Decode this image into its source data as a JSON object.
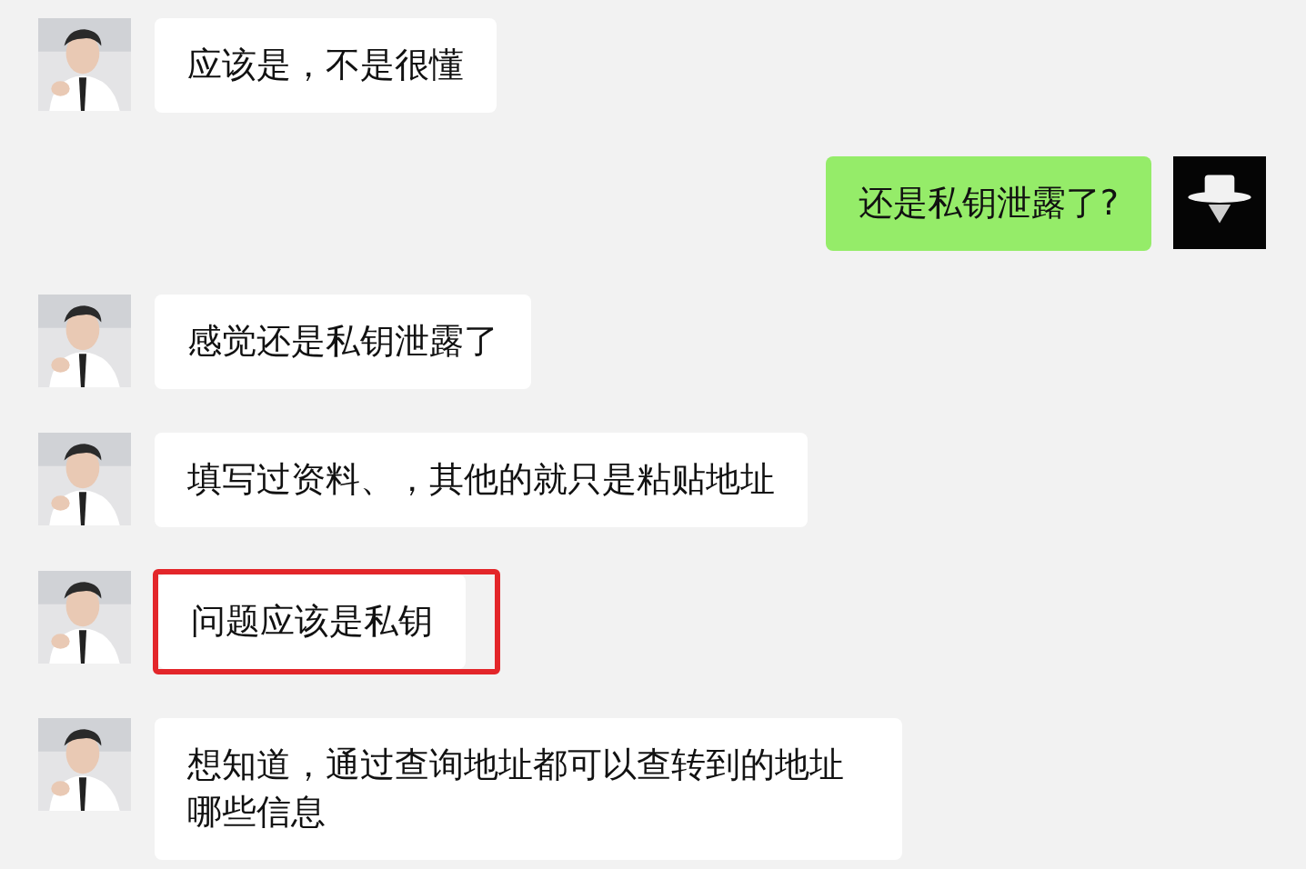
{
  "messages": [
    {
      "kind": "received",
      "text": "应该是，不是很懂",
      "highlighted": false
    },
    {
      "kind": "sent",
      "text": "还是私钥泄露了?",
      "highlighted": false
    },
    {
      "kind": "received",
      "text": "感觉还是私钥泄露了",
      "highlighted": false
    },
    {
      "kind": "received",
      "text": "填写过资料、，其他的就只是粘贴地址",
      "highlighted": false
    },
    {
      "kind": "received",
      "text": "问题应该是私钥",
      "highlighted": true
    },
    {
      "kind": "received",
      "text": "想知道，通过查询地址都可以查转到的地址哪些信息",
      "highlighted": false
    }
  ]
}
